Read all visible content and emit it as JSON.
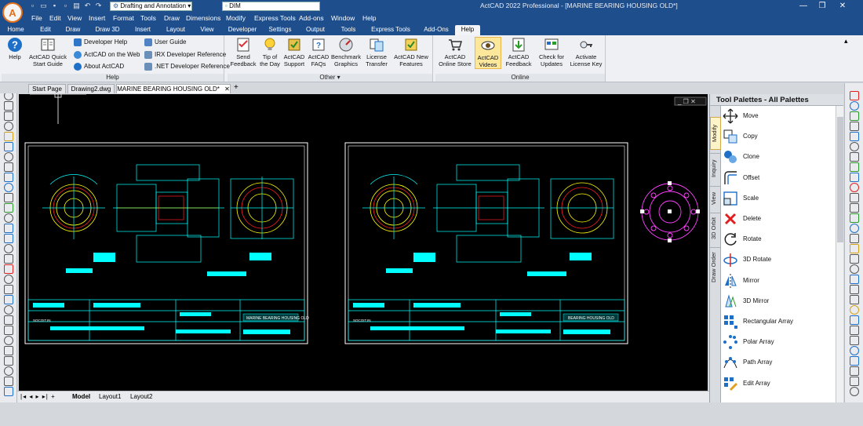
{
  "window": {
    "title": "ActCAD 2022 Professional - [MARINE BEARING HOUSING OLD*]",
    "workspace": "Drafting and Annotation",
    "layer": "DIM",
    "minimize": "—",
    "restore": "❐",
    "close": "✕"
  },
  "menubar": [
    "File",
    "Edit",
    "View",
    "Insert",
    "Format",
    "Tools",
    "Draw",
    "Dimensions",
    "Modify",
    "Express Tools",
    "Add-ons",
    "Window",
    "Help"
  ],
  "ribbon_tabs": [
    "Home",
    "Edit",
    "Draw",
    "Draw 3D",
    "Insert",
    "Layout",
    "View",
    "Developer",
    "Settings",
    "Output",
    "Tools",
    "Express Tools",
    "Add-Ons",
    "Help"
  ],
  "active_ribbon_tab": "Help",
  "ribbon": {
    "help_panel": {
      "label": "Help",
      "help": "Help",
      "quick_start": "ActCAD Quick Start Guide",
      "developer_help": "Developer Help",
      "actcad_web": "ActCAD on the Web",
      "about": "About ActCAD",
      "user_guide": "User Guide",
      "irx_ref": "IRX Developer Reference",
      "net_ref": ".NET Developer Reference"
    },
    "other_panel": {
      "label": "Other ▾",
      "send_feedback": "Send Feedback",
      "tip": "Tip of the Day",
      "support": "ActCAD Support",
      "faqs": "ActCAD FAQs",
      "benchmark": "Benchmark Graphics",
      "license_transfer": "License Transfer",
      "new_features": "ActCAD New Features"
    },
    "online_panel": {
      "label": "Online",
      "store": "ActCAD Online Store",
      "videos": "ActCAD Videos",
      "feedback": "ActCAD Feedback",
      "updates": "Check for Updates",
      "activate": "Activate License Key"
    }
  },
  "doc_tabs": [
    "Start Page",
    "Drawing2.dwg",
    "MARINE BEARING HOUSING OLD*"
  ],
  "doc_tab_close": "✕",
  "doc_tab_add": "+",
  "drawing": {
    "left_sheet_title": "MARINE BEARING HOUSING OLD",
    "right_sheet_title": "BEARING HOUSING OLD",
    "logo_left": "SOCOIT.IN",
    "logo_right": "SOCOIT.IN"
  },
  "model_tabs": [
    "Model",
    "Layout1",
    "Layout2"
  ],
  "palette": {
    "title": "Tool Palettes - All Palettes",
    "side_tabs": [
      "Modify",
      "Inquiry",
      "View",
      "3D Orbit",
      "Draw Order"
    ],
    "items": [
      {
        "label": "Move",
        "icon": "move-icon"
      },
      {
        "label": "Copy",
        "icon": "copy-icon"
      },
      {
        "label": "Clone",
        "icon": "clone-icon"
      },
      {
        "label": "Offset",
        "icon": "offset-icon"
      },
      {
        "label": "Scale",
        "icon": "scale-icon"
      },
      {
        "label": "Delete",
        "icon": "delete-icon"
      },
      {
        "label": "Rotate",
        "icon": "rotate-icon"
      },
      {
        "label": "3D Rotate",
        "icon": "rotate-3d-icon"
      },
      {
        "label": "Mirror",
        "icon": "mirror-icon"
      },
      {
        "label": "3D Mirror",
        "icon": "mirror-3d-icon"
      },
      {
        "label": "Rectangular Array",
        "icon": "rect-array-icon"
      },
      {
        "label": "Polar Array",
        "icon": "polar-array-icon"
      },
      {
        "label": "Path Array",
        "icon": "path-array-icon"
      },
      {
        "label": "Edit Array",
        "icon": "edit-array-icon"
      }
    ]
  },
  "colors": {
    "titlebar": "#1f4e8c",
    "cad_cyan": "#00ffff",
    "cad_yellow": "#ffff00",
    "cad_red": "#ff2020",
    "cad_magenta": "#ff40ff",
    "selected_button": "#fde79a"
  }
}
